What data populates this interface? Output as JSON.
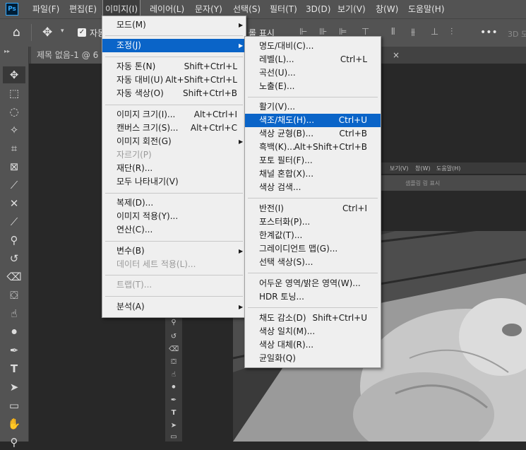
{
  "menubar": {
    "logo": "Ps",
    "items": [
      "파일(F)",
      "편집(E)",
      "이미지(I)",
      "레이어(L)",
      "문자(Y)",
      "선택(S)",
      "필터(T)",
      "3D(D)",
      "보기(V)",
      "창(W)",
      "도움말(H)"
    ]
  },
  "options_bar": {
    "auto_select_label": "자동",
    "transform_label": "롤 표시",
    "right_label": "3D 모"
  },
  "document": {
    "tab_title": "제목 없음-1 @ 6",
    "close_glyph": "×"
  },
  "background_window": {
    "menu_items": [
      "보기(V)",
      "창(W)",
      "도움말(H)"
    ],
    "option_text": "샘플링 링 표시"
  },
  "image_menu": {
    "items": [
      {
        "label": "모드(M)",
        "shortcut": "",
        "submenu": true,
        "disabled": false
      },
      {
        "label": "조정(J)",
        "shortcut": "",
        "submenu": true,
        "disabled": false,
        "highlighted": true
      },
      {
        "label": "자동 톤(N)",
        "shortcut": "Shift+Ctrl+L",
        "submenu": false,
        "disabled": false
      },
      {
        "label": "자동 대비(U)",
        "shortcut": "Alt+Shift+Ctrl+L",
        "submenu": false,
        "disabled": false
      },
      {
        "label": "자동 색상(O)",
        "shortcut": "Shift+Ctrl+B",
        "submenu": false,
        "disabled": false
      },
      {
        "label": "이미지 크기(I)...",
        "shortcut": "Alt+Ctrl+I",
        "submenu": false,
        "disabled": false
      },
      {
        "label": "캔버스 크기(S)...",
        "shortcut": "Alt+Ctrl+C",
        "submenu": false,
        "disabled": false
      },
      {
        "label": "이미지 회전(G)",
        "shortcut": "",
        "submenu": true,
        "disabled": false
      },
      {
        "label": "자르기(P)",
        "shortcut": "",
        "submenu": false,
        "disabled": true
      },
      {
        "label": "재단(R)...",
        "shortcut": "",
        "submenu": false,
        "disabled": false
      },
      {
        "label": "모두 나타내기(V)",
        "shortcut": "",
        "submenu": false,
        "disabled": false
      },
      {
        "label": "복제(D)...",
        "shortcut": "",
        "submenu": false,
        "disabled": false
      },
      {
        "label": "이미지 적용(Y)...",
        "shortcut": "",
        "submenu": false,
        "disabled": false
      },
      {
        "label": "연산(C)...",
        "shortcut": "",
        "submenu": false,
        "disabled": false
      },
      {
        "label": "변수(B)",
        "shortcut": "",
        "submenu": true,
        "disabled": false
      },
      {
        "label": "데이터 세트 적용(L)...",
        "shortcut": "",
        "submenu": false,
        "disabled": true
      },
      {
        "label": "트랩(T)...",
        "shortcut": "",
        "submenu": false,
        "disabled": true
      },
      {
        "label": "분석(A)",
        "shortcut": "",
        "submenu": true,
        "disabled": false
      }
    ]
  },
  "adjust_menu": {
    "items": [
      {
        "label": "명도/대비(C)...",
        "shortcut": ""
      },
      {
        "label": "레벨(L)...",
        "shortcut": "Ctrl+L"
      },
      {
        "label": "곡선(U)...",
        "shortcut": ""
      },
      {
        "label": "노출(E)...",
        "shortcut": ""
      },
      {
        "label": "활기(V)...",
        "shortcut": ""
      },
      {
        "label": "색조/채도(H)...",
        "shortcut": "Ctrl+U",
        "highlighted": true
      },
      {
        "label": "색상 균형(B)...",
        "shortcut": "Ctrl+B"
      },
      {
        "label": "흑백(K)...",
        "shortcut": "Alt+Shift+Ctrl+B"
      },
      {
        "label": "포토 필터(F)...",
        "shortcut": ""
      },
      {
        "label": "채널 혼합(X)...",
        "shortcut": ""
      },
      {
        "label": "색상 검색...",
        "shortcut": ""
      },
      {
        "label": "반전(I)",
        "shortcut": "Ctrl+I"
      },
      {
        "label": "포스터화(P)...",
        "shortcut": ""
      },
      {
        "label": "한계값(T)...",
        "shortcut": ""
      },
      {
        "label": "그레이디언트 맵(G)...",
        "shortcut": ""
      },
      {
        "label": "선택 색상(S)...",
        "shortcut": ""
      },
      {
        "label": "어두운 영역/밝은 영역(W)...",
        "shortcut": ""
      },
      {
        "label": "HDR 토닝...",
        "shortcut": ""
      },
      {
        "label": "채도 감소(D)",
        "shortcut": "Shift+Ctrl+U"
      },
      {
        "label": "색상 일치(M)...",
        "shortcut": ""
      },
      {
        "label": "색상 대체(R)...",
        "shortcut": ""
      },
      {
        "label": "균일화(Q)",
        "shortcut": ""
      }
    ]
  }
}
